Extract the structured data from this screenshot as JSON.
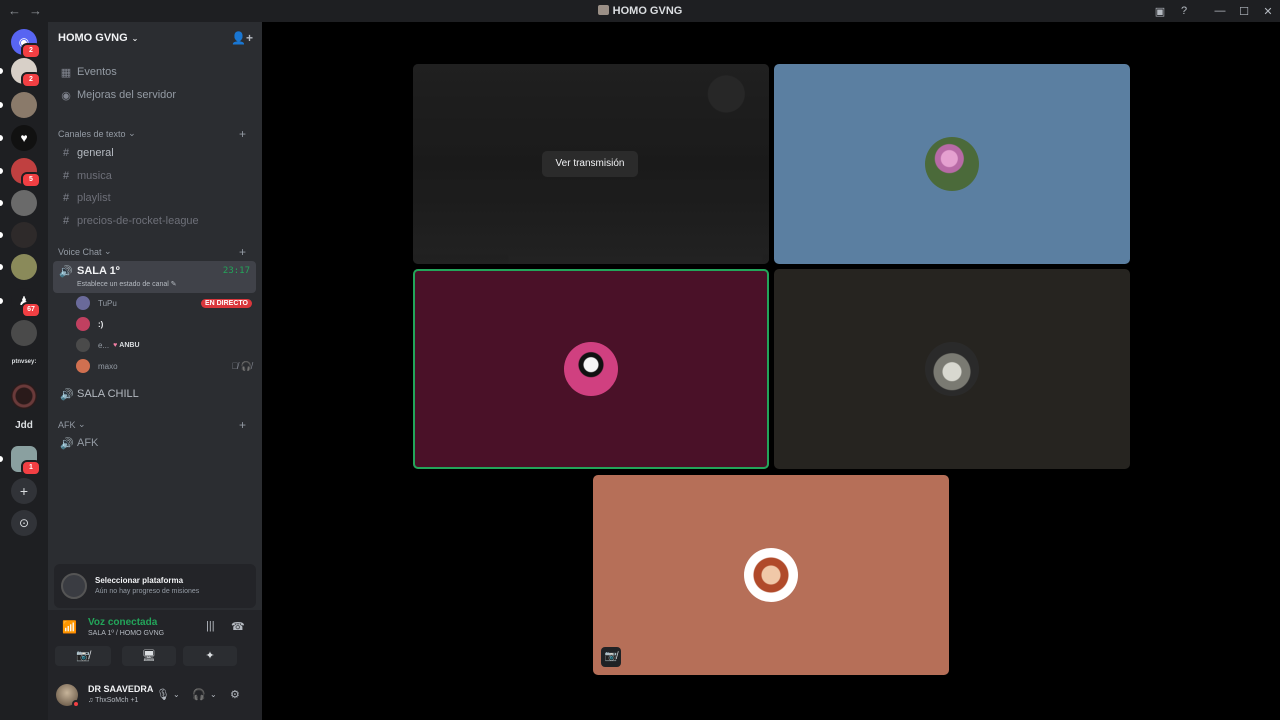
{
  "window": {
    "title": "HOMO GVNG",
    "back": "←",
    "forward": "→",
    "controls": {
      "inbox": "▣",
      "help": "?",
      "minimize": "—",
      "maximize": "☐",
      "close": "✕"
    }
  },
  "rail": {
    "servers": [
      {
        "name": "discord-home",
        "badge": "2",
        "color": "#5865f2",
        "glyph": "◉"
      },
      {
        "name": "dm-avatar",
        "badge": "2",
        "color": "#d8d0c8"
      },
      {
        "name": "server-voice-active",
        "badge": "",
        "color": "#8a7a6a"
      },
      {
        "name": "server-logo-v",
        "badge": "",
        "color": "#111111",
        "glyph": "♥"
      },
      {
        "name": "server-collage",
        "badge": "5",
        "color": "#c04040"
      },
      {
        "name": "server-grey",
        "badge": "",
        "color": "#6a6a6a"
      },
      {
        "name": "server-dark-photo",
        "badge": "",
        "color": "#2e2a2a"
      },
      {
        "name": "server-anime",
        "badge": "",
        "color": "#8a8a5a"
      },
      {
        "name": "server-tall",
        "badge": "67",
        "color": "#1e1f22",
        "glyph": "♟"
      },
      {
        "name": "server-masked",
        "badge": "",
        "color": "#4a4a4a"
      }
    ],
    "text_servers": [
      "ptnvsey:",
      "Jdd"
    ],
    "extra": [
      {
        "name": "server-dark-ring",
        "badge": "",
        "color": "#2a1a1a"
      },
      {
        "name": "server-hand",
        "badge": "1",
        "color": "#8aa0a0"
      }
    ],
    "add_label": "+",
    "discover_label": "⊙"
  },
  "sidebar": {
    "server_name": "HOMO GVNG",
    "chevron": "⌄",
    "invite_icon": "👤+",
    "items": [
      {
        "icon": "▦",
        "label": "Eventos"
      },
      {
        "icon": "◉",
        "label": "Mejoras del servidor"
      }
    ],
    "text_category": "Canales de texto",
    "text_channels": [
      "general",
      "musica",
      "playlist",
      "precios-de-rocket-league"
    ],
    "voice_category": "Voice Chat",
    "active_voice": {
      "name": "SALA 1º",
      "time": "23:17",
      "status": "Establece un estado de canal ✎"
    },
    "voice_users": [
      {
        "name": "TuPu",
        "live": "EN DIRECTO",
        "color": "#6a6a9a"
      },
      {
        "name": ":)",
        "live": "",
        "color": "#c04060"
      },
      {
        "name": "e...",
        "tag": "ANBU",
        "color": "#4a4a4a"
      },
      {
        "name": "maxo",
        "icons": "🎙̸ 🎧̸",
        "color": "#d07050"
      }
    ],
    "other_voice": "SALA CHILL",
    "afk_category": "AFK",
    "afk_channel": "AFK",
    "hash": "#",
    "speaker": "🔊",
    "plus": "+",
    "cat_chevron": "⌄"
  },
  "quest": {
    "title": "Seleccionar plataforma",
    "subtitle": "Aún no hay progreso de misiones"
  },
  "voice_panel": {
    "status": "Voz conectada",
    "location": "SALA 1º / HOMO GVNG",
    "buttons": [
      "📷̸",
      "🖥",
      "✦",
      "🚀"
    ]
  },
  "user": {
    "name": "DR SAAVEDRA",
    "activity": "♫ ThxSoMch +1",
    "icons": [
      "🎙",
      "⌄",
      "🎧",
      "⌄",
      "⚙"
    ]
  },
  "stage": {
    "stream_button": "Ver transmisión",
    "tiles": [
      {
        "name": "tile-stream",
        "kind": "stream"
      },
      {
        "name": "tile-pink-panther",
        "bg": "#5b7fa1",
        "avatar": "#c07ab0"
      },
      {
        "name": "tile-skull",
        "bg": "#4a1128",
        "avatar": "#d04080",
        "speaking": true
      },
      {
        "name": "tile-cat",
        "bg": "#262420",
        "avatar": "#8a8a88"
      },
      {
        "name": "tile-chucky",
        "bg": "#b66f58",
        "avatar": "#b05a3a",
        "muted": "📷̸"
      }
    ]
  }
}
